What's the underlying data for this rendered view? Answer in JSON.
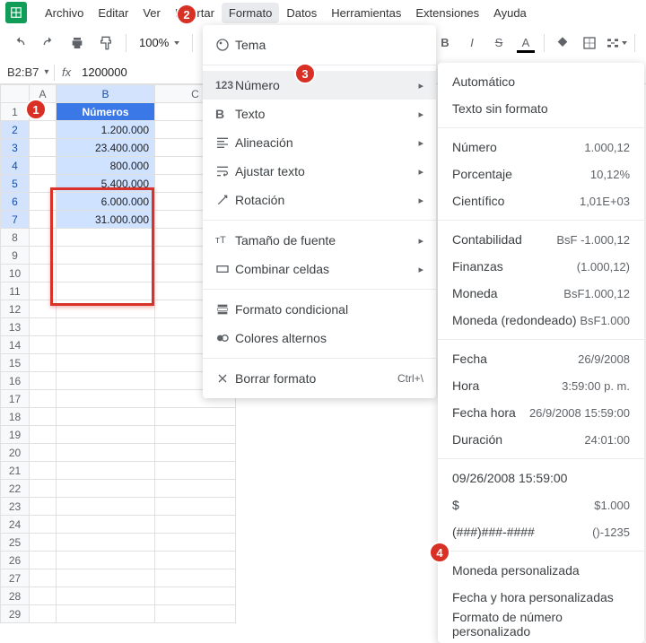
{
  "menubar": {
    "items": [
      "Archivo",
      "Editar",
      "Ver",
      "Insertar",
      "Formato",
      "Datos",
      "Herramientas",
      "Extensiones",
      "Ayuda"
    ],
    "active_index": 4
  },
  "toolbar": {
    "zoom": "100%",
    "currency": "BsF"
  },
  "namebox": {
    "ref": "B2:B7",
    "formula": "1200000"
  },
  "columns": [
    "A",
    "B",
    "C"
  ],
  "sheet": {
    "header": "Números",
    "data": [
      "1.200.000",
      "23.400.000",
      "800.000",
      "5.400.000",
      "6.000.000",
      "31.000.000"
    ],
    "rows": 29
  },
  "format_menu": {
    "tema": "Tema",
    "numero": "Número",
    "texto": "Texto",
    "alineacion": "Alineación",
    "ajustar": "Ajustar texto",
    "rotacion": "Rotación",
    "tamano": "Tamaño de fuente",
    "combinar": "Combinar celdas",
    "condicional": "Formato condicional",
    "alternos": "Colores alternos",
    "borrar": "Borrar formato",
    "borrar_short": "Ctrl+\\"
  },
  "number_menu": {
    "sections": [
      [
        {
          "label": "Automático",
          "val": ""
        },
        {
          "label": "Texto sin formato",
          "val": ""
        }
      ],
      [
        {
          "label": "Número",
          "val": "1.000,12"
        },
        {
          "label": "Porcentaje",
          "val": "10,12%"
        },
        {
          "label": "Científico",
          "val": "1,01E+03"
        }
      ],
      [
        {
          "label": "Contabilidad",
          "val": "BsF -1.000,12"
        },
        {
          "label": "Finanzas",
          "val": "(1.000,12)"
        },
        {
          "label": "Moneda",
          "val": "BsF1.000,12"
        },
        {
          "label": "Moneda (redondeado)",
          "val": "BsF1.000"
        }
      ],
      [
        {
          "label": "Fecha",
          "val": "26/9/2008"
        },
        {
          "label": "Hora",
          "val": "3:59:00 p. m."
        },
        {
          "label": "Fecha hora",
          "val": "26/9/2008 15:59:00"
        },
        {
          "label": "Duración",
          "val": "24:01:00"
        }
      ],
      [
        {
          "label": "09/26/2008 15:59:00",
          "val": ""
        },
        {
          "label": "$",
          "val": "$1.000"
        },
        {
          "label": "(###)###-####",
          "val": "()-1235"
        }
      ],
      [
        {
          "label": "Moneda personalizada",
          "val": ""
        },
        {
          "label": "Fecha y hora personalizadas",
          "val": ""
        },
        {
          "label": "Formato de número personalizado",
          "val": "",
          "final": true
        }
      ]
    ]
  },
  "badges": {
    "b1": "1",
    "b2": "2",
    "b3": "3",
    "b4": "4"
  }
}
